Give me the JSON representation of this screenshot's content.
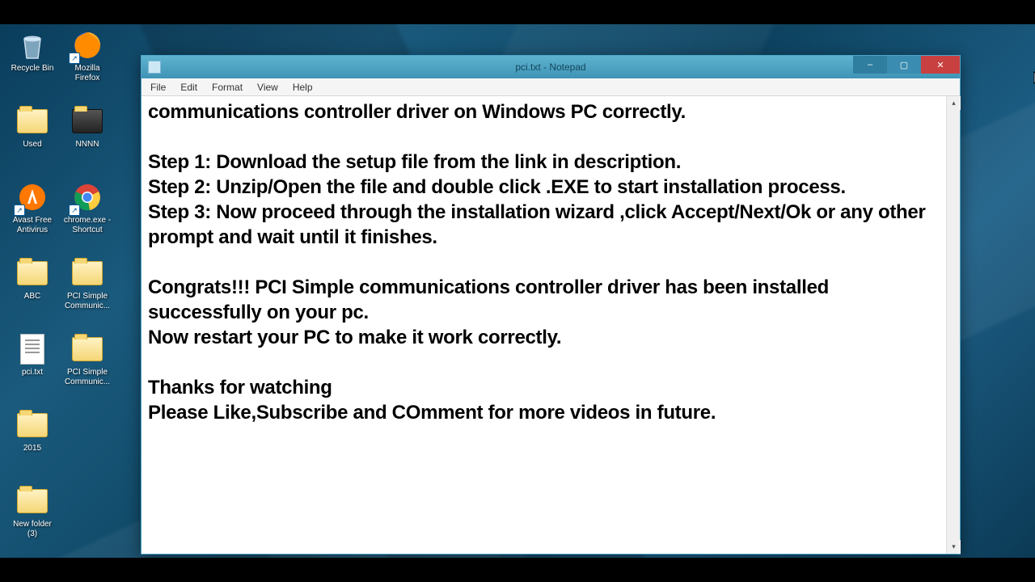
{
  "desktop_icons": [
    {
      "name": "recycle-bin",
      "label": "Recycle Bin",
      "kind": "bin"
    },
    {
      "name": "firefox",
      "label": "Mozilla Firefox",
      "kind": "firefox"
    },
    {
      "name": "used-folder",
      "label": "Used",
      "kind": "folder"
    },
    {
      "name": "nnnn-folder",
      "label": "NNNN",
      "kind": "folder-dark"
    },
    {
      "name": "avast",
      "label": "Avast Free Antivirus",
      "kind": "avast"
    },
    {
      "name": "chrome",
      "label": "chrome.exe - Shortcut",
      "kind": "chrome"
    },
    {
      "name": "abc-folder",
      "label": "ABC",
      "kind": "folder"
    },
    {
      "name": "pci-folder-1",
      "label": "PCI Simple Communic...",
      "kind": "folder"
    },
    {
      "name": "pci-txt",
      "label": "pci.txt",
      "kind": "textfile"
    },
    {
      "name": "pci-folder-2",
      "label": "PCI Simple Communic...",
      "kind": "folder"
    },
    {
      "name": "2015-folder",
      "label": "2015",
      "kind": "folder"
    },
    {
      "name": "empty-slot",
      "label": "",
      "kind": "none"
    },
    {
      "name": "new-folder-3",
      "label": "New folder (3)",
      "kind": "folder"
    }
  ],
  "notepad": {
    "title": "pci.txt - Notepad",
    "menus": [
      "File",
      "Edit",
      "Format",
      "View",
      "Help"
    ],
    "content": "communications controller driver on Windows PC correctly.\n\nStep 1: Download the setup file from the link in description.\nStep 2: Unzip/Open the file and double click .EXE to start installation process.\nStep 3: Now proceed through the installation wizard ,click Accept/Next/Ok or any other prompt and wait until it finishes.\n\nCongrats!!! PCI Simple communications controller driver has been installed successfully on your pc.\nNow restart your PC to make it work correctly.\n\nThanks for watching\nPlease Like,Subscribe and COmment for more videos in future.",
    "window_controls": {
      "minimize": "–",
      "maximize": "▢",
      "close": "✕"
    }
  }
}
